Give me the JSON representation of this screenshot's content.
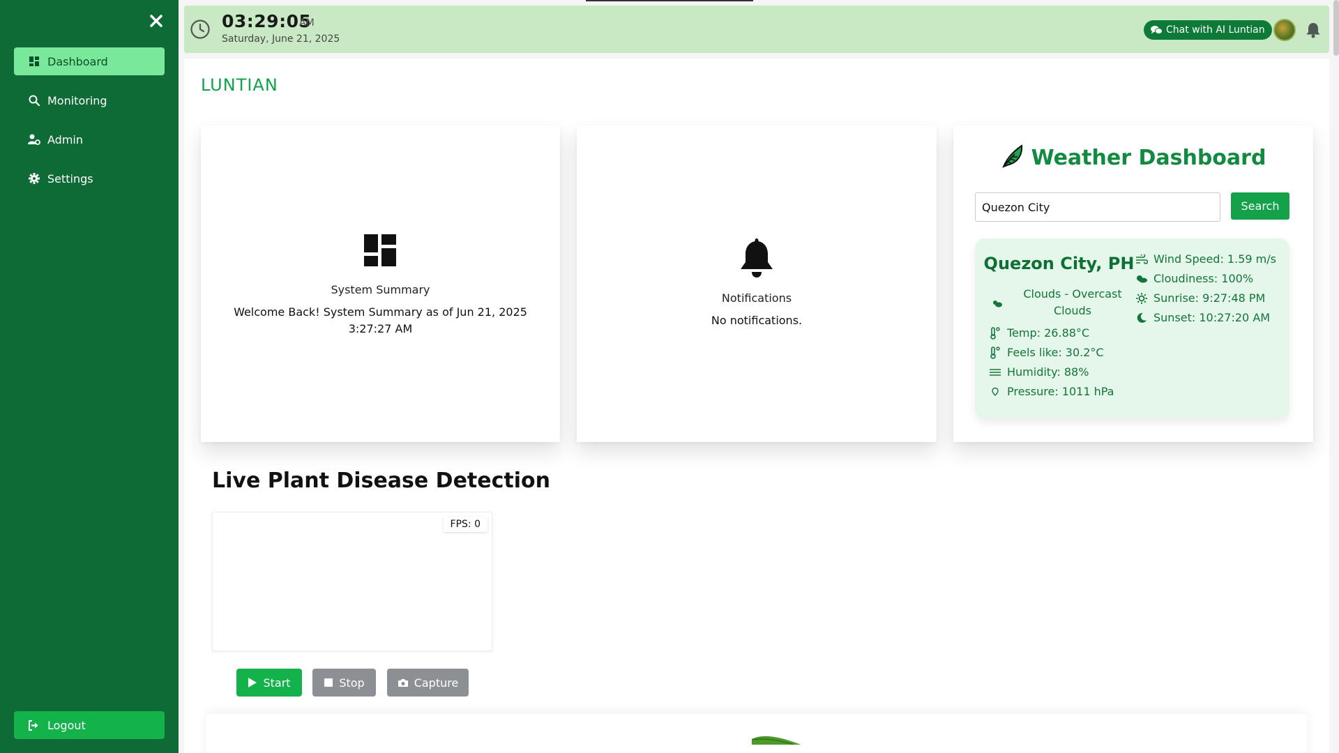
{
  "sidebar": {
    "items": [
      {
        "label": "Dashboard",
        "icon": "dashboard-icon"
      },
      {
        "label": "Monitoring",
        "icon": "search-icon"
      },
      {
        "label": "Admin",
        "icon": "user-gear-icon"
      },
      {
        "label": "Settings",
        "icon": "gear-icon"
      }
    ],
    "logout_label": "Logout"
  },
  "header": {
    "time": "03:29:05",
    "ampm": "AM",
    "date": "Saturday, June 21, 2025",
    "chat_label": "Chat with AI Luntian"
  },
  "main": {
    "brand": "LUNTIAN",
    "summary": {
      "title": "System Summary",
      "text": "Welcome Back! System Summary as of Jun 21, 2025 3:27:27 AM"
    },
    "notifications": {
      "title": "Notifications",
      "text": "No notifications."
    },
    "weather": {
      "title": "Weather Dashboard",
      "search_value": "Quezon City",
      "search_label": "Search",
      "city": "Quezon City, PH",
      "condition": "Clouds - Overcast Clouds",
      "temp": "Temp: 26.88°C",
      "feels_like": "Feels like: 30.2°C",
      "humidity": "Humidity: 88%",
      "pressure": "Pressure: 1011 hPa",
      "wind": "Wind Speed: 1.59 m/s",
      "cloudiness": "Cloudiness: 100%",
      "sunrise": "Sunrise: 9:27:48 PM",
      "sunset": "Sunset: 10:27:20 AM"
    },
    "detection": {
      "title": "Live Plant Disease Detection",
      "fps": "FPS: 0",
      "start_label": "Start",
      "stop_label": "Stop",
      "capture_label": "Capture"
    }
  },
  "colors": {
    "sidebar": "#0e6b35",
    "accent": "#13a24a",
    "active_nav": "#79e89b",
    "topbar": "#c8e9c4",
    "weather_box": "#e5f6ea",
    "disabled_button": "#8c9095"
  }
}
